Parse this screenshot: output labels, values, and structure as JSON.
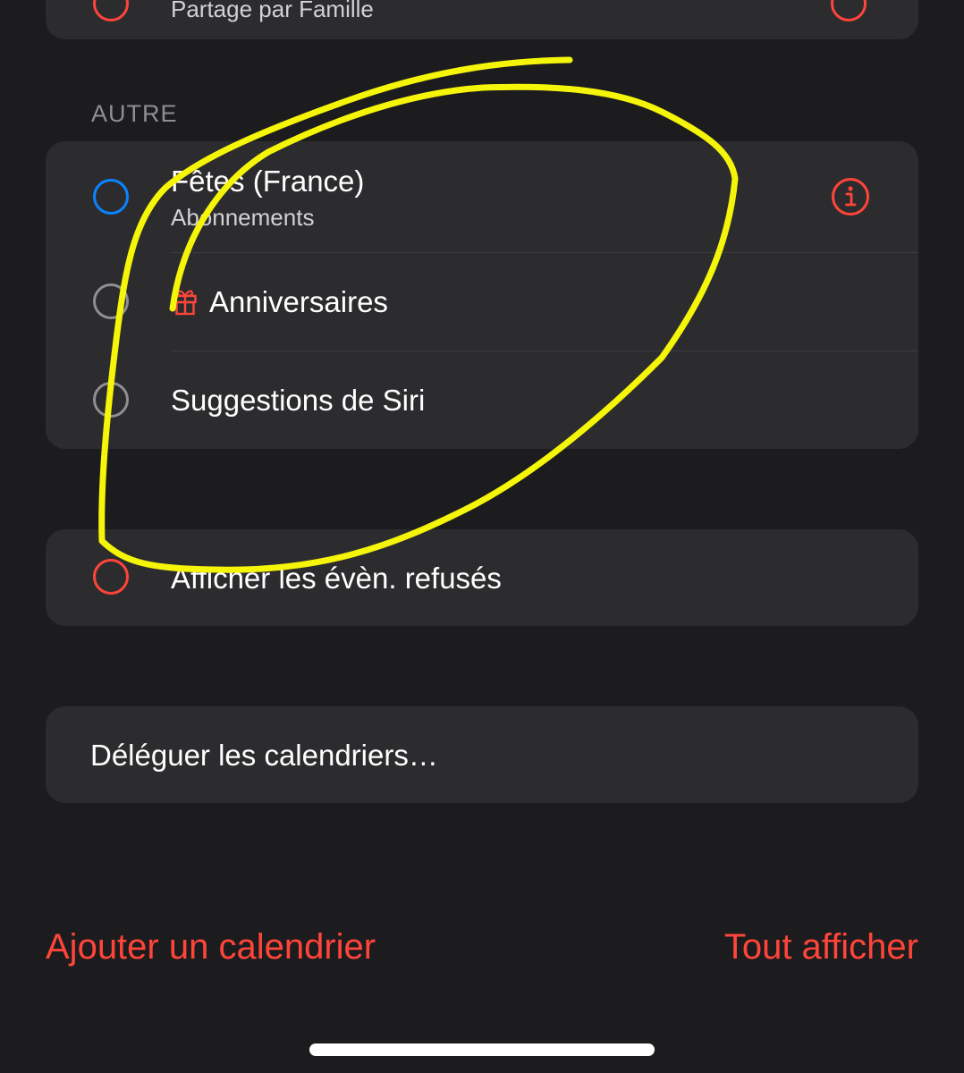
{
  "top_partial": {
    "subtitle": "Partage par Famille"
  },
  "section": {
    "header": "AUTRE"
  },
  "calendars": [
    {
      "title": "Fêtes (France)",
      "subtitle": "Abonnements",
      "color": "#0a84ff",
      "checked": false,
      "has_info": true
    },
    {
      "title": "Anniversaires",
      "icon": "gift-icon",
      "color": "#8e8e93",
      "checked": false
    },
    {
      "title": "Suggestions de Siri",
      "color": "#8e8e93",
      "checked": false
    }
  ],
  "declined": {
    "label": "Afficher les évèn. refusés",
    "color": "#ff453a",
    "checked": false
  },
  "delegate": {
    "label": "Déléguer les calendriers…"
  },
  "footer": {
    "add_label": "Ajouter un calendrier",
    "show_all_label": "Tout afficher"
  },
  "colors": {
    "accent": "#ff453a",
    "highlight": "#f5f50a",
    "background": "#1c1c1e",
    "cell": "#2c2c2e"
  }
}
